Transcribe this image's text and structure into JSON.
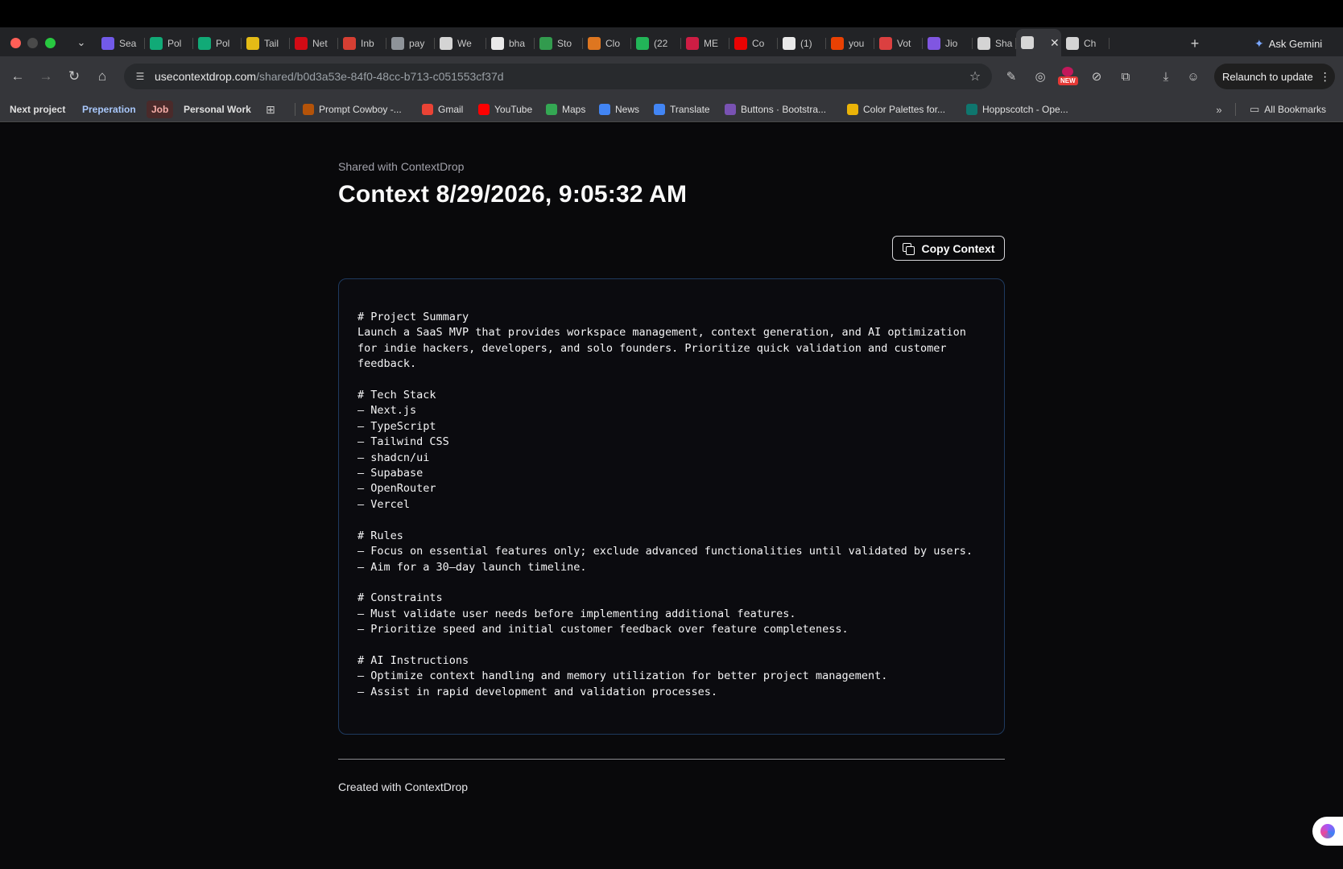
{
  "tabs": [
    {
      "label": "Sea",
      "icon": "colorful-dots-icon",
      "color": "#7b61ff"
    },
    {
      "label": "Pol",
      "icon": "bolt-icon",
      "color": "#10b981"
    },
    {
      "label": "Pol",
      "icon": "bolt-icon",
      "color": "#10b981"
    },
    {
      "label": "Tail",
      "icon": "sticky-note-icon",
      "color": "#facc15"
    },
    {
      "label": "Net",
      "icon": "netflix-icon",
      "color": "#e50914"
    },
    {
      "label": "Inb",
      "icon": "gmail-icon",
      "color": "#ea4335"
    },
    {
      "label": "pay",
      "icon": "globe-icon",
      "color": "#9aa0a6"
    },
    {
      "label": "We",
      "icon": "image-icon",
      "color": "#e8e8e8"
    },
    {
      "label": "bha",
      "icon": "github-icon",
      "color": "#ffffff"
    },
    {
      "label": "Sto",
      "icon": "google-drive-icon",
      "color": "#34a853"
    },
    {
      "label": "Clo",
      "icon": "cloud-icon",
      "color": "#f38020"
    },
    {
      "label": "(22",
      "icon": "badge-99-icon",
      "color": "#22c55e"
    },
    {
      "label": "ME",
      "icon": "m-logo-icon",
      "color": "#e11d48"
    },
    {
      "label": "Co",
      "icon": "youtube-icon",
      "color": "#ff0000"
    },
    {
      "label": "(1)",
      "icon": "x-logo-icon",
      "color": "#ffffff"
    },
    {
      "label": "you",
      "icon": "reddit-icon",
      "color": "#ff4500"
    },
    {
      "label": "Vot",
      "icon": "heart-icon",
      "color": "#ef4444"
    },
    {
      "label": "Jio",
      "icon": "jio-icon",
      "color": "#8b5cf6"
    },
    {
      "label": "Sha",
      "icon": "drop-icon",
      "color": "#e8e8e8"
    },
    {
      "label": "",
      "icon": "drop-icon",
      "color": "#e8e8e8",
      "active": true
    },
    {
      "label": "Ch",
      "icon": "openai-icon",
      "color": "#e8e8e8"
    }
  ],
  "ask_gemini": "Ask Gemini",
  "url": {
    "domain": "usecontextdrop.com",
    "path": "/shared/b0d3a53e-84f0-48cc-b713-c051553cf37d"
  },
  "relaunch_label": "Relaunch to update",
  "ext_new_badge": "NEW",
  "bookmarks": {
    "groups": [
      {
        "label": "Next project",
        "color": "#35363a"
      },
      {
        "label": "Preperation",
        "color": "#35363a",
        "text_color": "#a8c7fa"
      },
      {
        "label": "Job",
        "color": "#4a2a2a",
        "text_color": "#f6aea9"
      },
      {
        "label": "Personal Work",
        "color": "#35363a"
      }
    ],
    "items": [
      {
        "label": "Prompt Cowboy -...",
        "icon": "cowboy-icon",
        "color": "#b45309"
      },
      {
        "label": "Gmail",
        "icon": "gmail-icon",
        "color": "#ea4335"
      },
      {
        "label": "YouTube",
        "icon": "youtube-icon",
        "color": "#ff0000"
      },
      {
        "label": "Maps",
        "icon": "maps-pin-icon",
        "color": "#34a853"
      },
      {
        "label": "News",
        "icon": "news-icon",
        "color": "#4285f4"
      },
      {
        "label": "Translate",
        "icon": "translate-icon",
        "color": "#4285f4"
      },
      {
        "label": "Buttons · Bootstra...",
        "icon": "bootstrap-icon",
        "color": "#7952b3"
      },
      {
        "label": "Color Palettes for...",
        "icon": "palette-icon",
        "color": "#eab308"
      },
      {
        "label": "Hoppscotch - Ope...",
        "icon": "hoppscotch-icon",
        "color": "#0f766e"
      }
    ],
    "all_bookmarks": "All Bookmarks"
  },
  "page": {
    "shared_with": "Shared with ContextDrop",
    "title": "Context 8/29/2026, 9:05:32 AM",
    "copy_button": "Copy Context",
    "context_text": "# Project Summary\nLaunch a SaaS MVP that provides workspace management, context generation, and AI optimization\nfor indie hackers, developers, and solo founders. Prioritize quick validation and customer\nfeedback.\n\n# Tech Stack\n– Next.js\n– TypeScript\n– Tailwind CSS\n– shadcn/ui\n– Supabase\n– OpenRouter\n– Vercel\n\n# Rules\n– Focus on essential features only; exclude advanced functionalities until validated by users.\n– Aim for a 30–day launch timeline.\n\n# Constraints\n– Must validate user needs before implementing additional features.\n– Prioritize speed and initial customer feedback over feature completeness.\n\n# AI Instructions\n– Optimize context handling and memory utilization for better project management.\n– Assist in rapid development and validation processes.",
    "footer": "Created with ContextDrop"
  },
  "colors": {
    "page_bg": "#09090b",
    "card_border": "#1e3a5f",
    "chrome_bg": "#35363a"
  }
}
